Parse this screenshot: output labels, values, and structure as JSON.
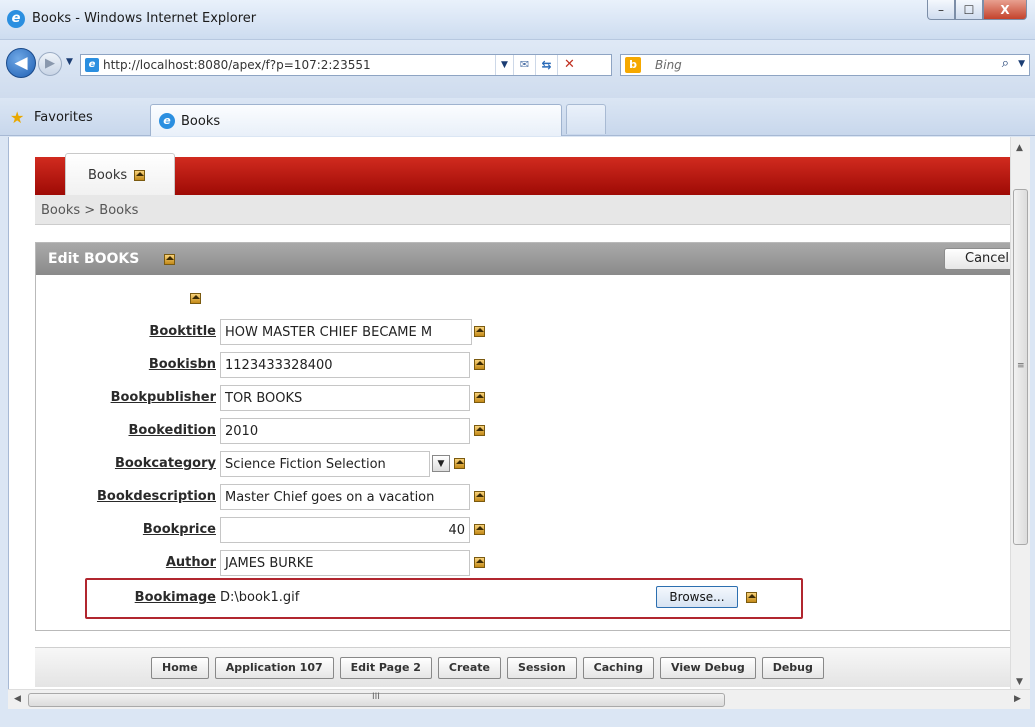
{
  "window": {
    "title": "Books - Windows Internet Explorer",
    "minimize": "–",
    "maximize": "☐",
    "close": "X"
  },
  "nav": {
    "back": "◀",
    "forward": "▶",
    "dropdown": "▼",
    "address": "http://localhost:8080/apex/f?p=107:2:23551",
    "address_icon": "e",
    "search_placeholder": "Bing",
    "search_icon_glyph": "b",
    "search_go": "⌕",
    "compat": "✉",
    "refresh": "⇆",
    "stop": "✕"
  },
  "favbar": {
    "favorites_label": "Favorites",
    "tab_label": "Books"
  },
  "apex": {
    "tab_label": "Books",
    "breadcrumb": "Books  >  Books",
    "region_title": "Edit BOOKS",
    "cancel_label": "Cancel"
  },
  "form": {
    "fields": [
      {
        "label": "Booktitle",
        "value": "HOW MASTER CHIEF BECAME M"
      },
      {
        "label": "Bookisbn",
        "value": "1123433328400"
      },
      {
        "label": "Bookpublisher",
        "value": "TOR BOOKS"
      },
      {
        "label": "Bookedition",
        "value": "2010"
      },
      {
        "label": "Bookcategory",
        "value": "Science Fiction Selection"
      },
      {
        "label": "Bookdescription",
        "value": "Master Chief goes on a vacation"
      },
      {
        "label": "Bookprice",
        "value": "40"
      },
      {
        "label": "Author",
        "value": "JAMES BURKE"
      },
      {
        "label": "Bookimage",
        "value": "D:\\book1.gif"
      }
    ],
    "browse_label": "Browse..."
  },
  "devbar": {
    "buttons": [
      "Home",
      "Application 107",
      "Edit Page 2",
      "Create",
      "Session",
      "Caching",
      "View Debug",
      "Debug"
    ]
  },
  "scroll": {
    "v_up": "▲",
    "v_down": "▼",
    "h_left": "◀",
    "h_right": "▶",
    "v_grip": "≡",
    "h_grip": "III"
  },
  "colors": {
    "apex_header_red": "#b1120b",
    "highlight_border": "#b1262f",
    "region_header_gray": "#999999"
  }
}
